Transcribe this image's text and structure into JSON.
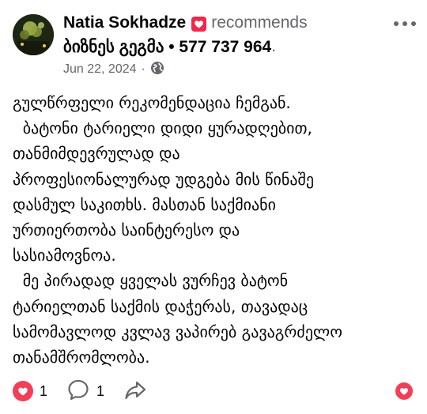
{
  "author": {
    "name": "Natia Sokhadze",
    "action": "recommends"
  },
  "page": {
    "name": "ბიზნეს გეგმა • 577 737 964",
    "trailing": "."
  },
  "meta": {
    "date": "Jun 22, 2024",
    "separator": "·",
    "privacy_icon": "globe-icon"
  },
  "post": {
    "lines": [
      "გულწრფელი რეკომენდაცია ჩემგან.",
      "  ბატონი ტარიელი დიდი ყურადღებით,",
      "თანმიმდევრულად და",
      "პროფესიონალურად უდგება მის წინაშე",
      "დასმულ საკითხს. მასთან საქმიანი",
      "ურთიერთობა საინტერესო და",
      "სასიამოვნოა.",
      "  მე პირადად ყველას ვურჩევ ბატონ",
      "ტარიელთან საქმის დაჭერას, თავადაც",
      "სამომავლოდ კვლავ ვაპირებ გავაგრძელო",
      "თანამშრომლობა."
    ]
  },
  "actions": {
    "reactions_count": "1",
    "comments_count": "1",
    "reaction_icon": "heart-icon",
    "comment_icon": "comment-icon",
    "share_icon": "share-icon"
  },
  "colors": {
    "recommend_badge": "#f02849",
    "heart": "#f33e58",
    "muted": "#65676b"
  }
}
